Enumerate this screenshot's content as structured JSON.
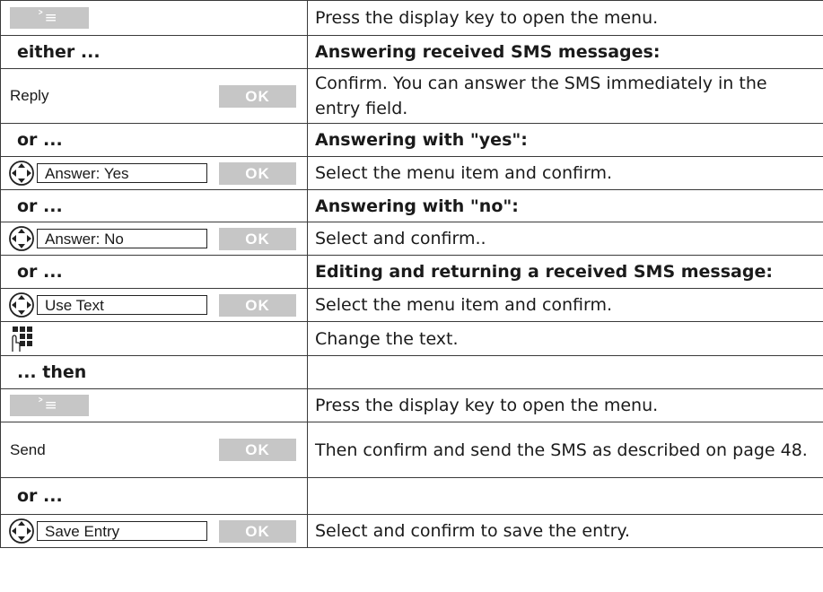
{
  "rows": {
    "r1": {
      "desc": "Press the display key to open the menu.",
      "icon": "menu-key-icon",
      "glyph": "˃≡"
    },
    "either": {
      "label": "either ...",
      "heading": "Answering received SMS messages:"
    },
    "reply": {
      "item": "Reply",
      "ok": "OK",
      "desc": "Confirm. You can answer the SMS immediately in the entry field."
    },
    "or1": {
      "label": "or ...",
      "heading": "Answering with \"yes\":"
    },
    "yes": {
      "item": "Answer: Yes",
      "ok": "OK",
      "desc": "Select the menu item and confirm.",
      "icon": "navigation-key-icon"
    },
    "or2": {
      "label": "or ...",
      "heading": "Answering with \"no\":"
    },
    "no": {
      "item": "Answer: No",
      "ok": "OK",
      "desc": "Select and confirm..",
      "icon": "navigation-key-icon"
    },
    "or3": {
      "label": "or ...",
      "heading": "Editing and returning a received SMS message:"
    },
    "usetext": {
      "item": "Use Text",
      "ok": "OK",
      "desc": "Select the menu item and confirm.",
      "icon": "navigation-key-icon"
    },
    "change": {
      "desc": "Change the text.",
      "icon": "keypad-icon"
    },
    "then": {
      "label": "... then"
    },
    "menu2": {
      "desc": "Press the display key to open the menu.",
      "icon": "menu-key-icon",
      "glyph": "˃≡"
    },
    "send": {
      "item": "Send",
      "ok": "OK",
      "desc": "Then confirm and send the SMS as described on page 48."
    },
    "or4": {
      "label": "or ..."
    },
    "save": {
      "item": "Save Entry",
      "ok": "OK",
      "desc": "Select and confirm to save the entry.",
      "icon": "navigation-key-icon"
    }
  }
}
